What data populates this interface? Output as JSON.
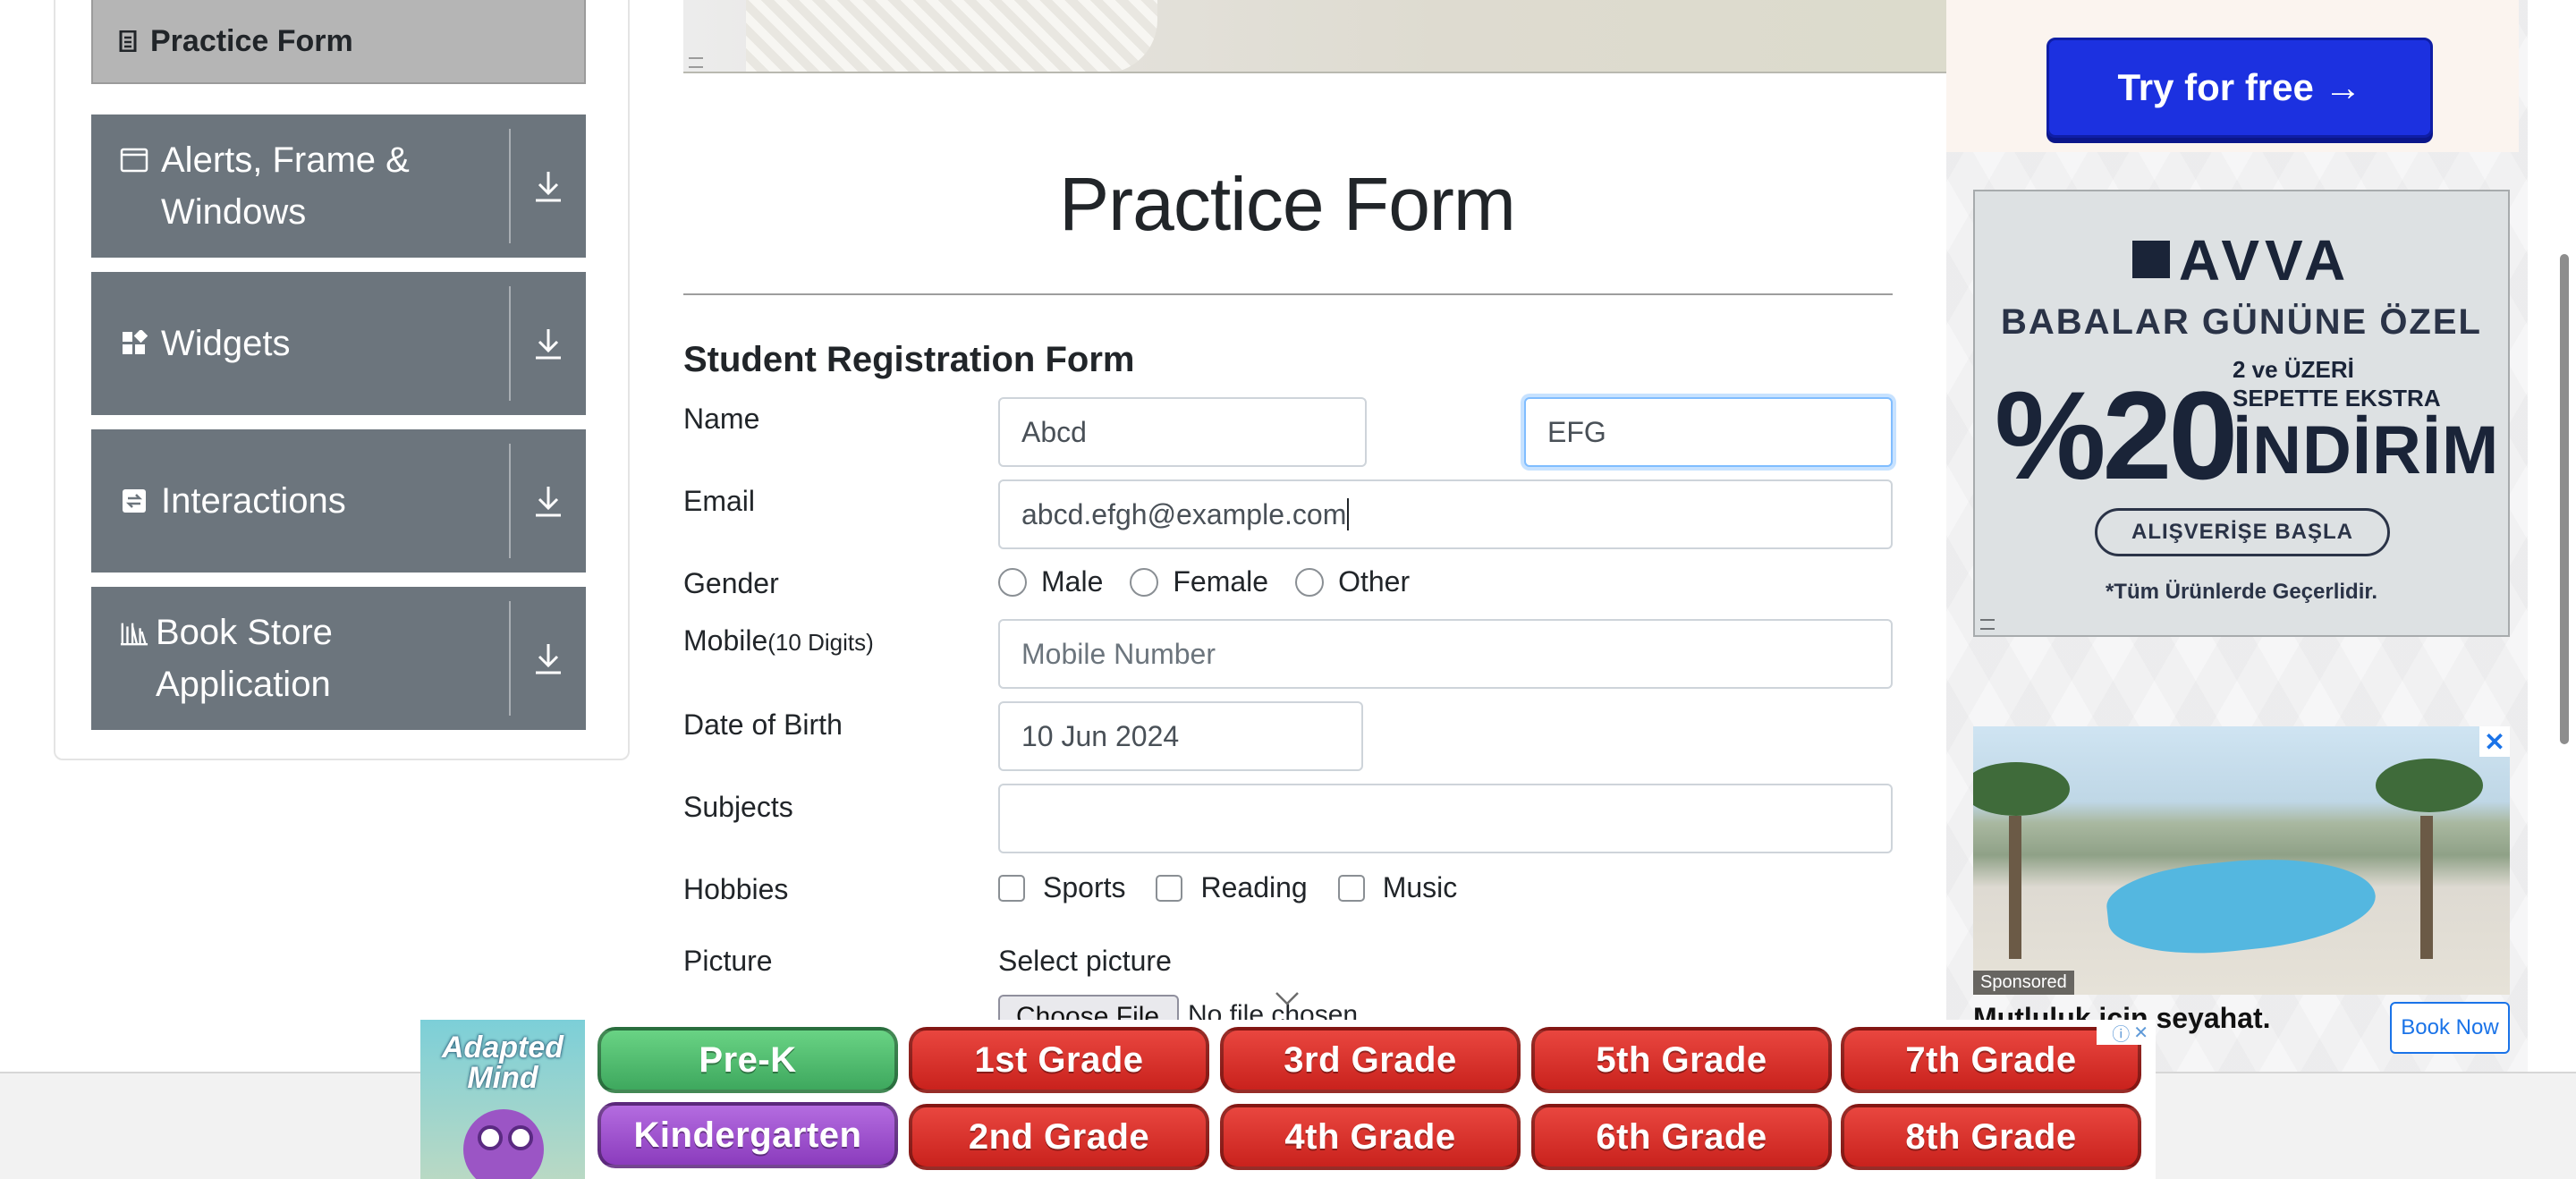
{
  "sidebar": {
    "active_item": {
      "label": "Practice Form",
      "icon": "document-icon"
    },
    "groups": [
      {
        "label": "Alerts, Frame &",
        "label2": "Windows",
        "icon": "window-icon"
      },
      {
        "label": "Widgets",
        "icon": "widgets-icon"
      },
      {
        "label": "Interactions",
        "icon": "interactions-icon"
      },
      {
        "label": "Book Store Application",
        "icon": "books-icon"
      }
    ]
  },
  "main": {
    "title": "Practice Form",
    "form_title": "Student Registration Form",
    "labels": {
      "name": "Name",
      "email": "Email",
      "gender": "Gender",
      "mobile": "Mobile",
      "mobile_hint": "(10 Digits)",
      "dob": "Date of Birth",
      "subjects": "Subjects",
      "hobbies": "Hobbies",
      "picture": "Picture"
    },
    "first_name": "Abcd",
    "last_name": "EFG",
    "email": "abcd.efgh@example.com",
    "gender_options": [
      "Male",
      "Female",
      "Other"
    ],
    "mobile_placeholder": "Mobile Number",
    "dob": "10 Jun 2024",
    "subjects_value": "",
    "hobbies": [
      "Sports",
      "Reading",
      "Music"
    ],
    "select_picture": "Select picture",
    "choose_file": "Choose File",
    "no_file": "No file chosen"
  },
  "ads": {
    "try_button": "Try for free →",
    "avva": {
      "brand": "AVVA",
      "headline": "BABALAR GÜNÜNE ÖZEL",
      "percent": "%20",
      "line1": "2 ve ÜZERİ",
      "line2": "SEPETTE EKSTRA",
      "big": "İNDİRİM",
      "button": "ALIŞVERİŞE BAŞLA",
      "footnote": "*Tüm Ürünlerde Geçerlidir."
    },
    "hotel": {
      "sponsored": "Sponsored",
      "title": "Mutluluk için seyahat.",
      "book_now": "Book Now",
      "close": "✕"
    },
    "adaptedmind": {
      "logo_line1": "Adapted",
      "logo_line2": "Mind",
      "grades": [
        "Pre-K",
        "1st Grade",
        "3rd Grade",
        "5th Grade",
        "7th Grade",
        "Kindergarten",
        "2nd Grade",
        "4th Grade",
        "6th Grade",
        "8th Grade"
      ]
    }
  },
  "colors": {
    "sidebar_group": "#6c757d",
    "active_item": "#b5b5b5",
    "focus_border": "#80bdff",
    "try_button": "#1c31e0",
    "grade_red": "#d6312b",
    "grade_green": "#4fbd6c",
    "grade_purple": "#9f4fd0"
  }
}
